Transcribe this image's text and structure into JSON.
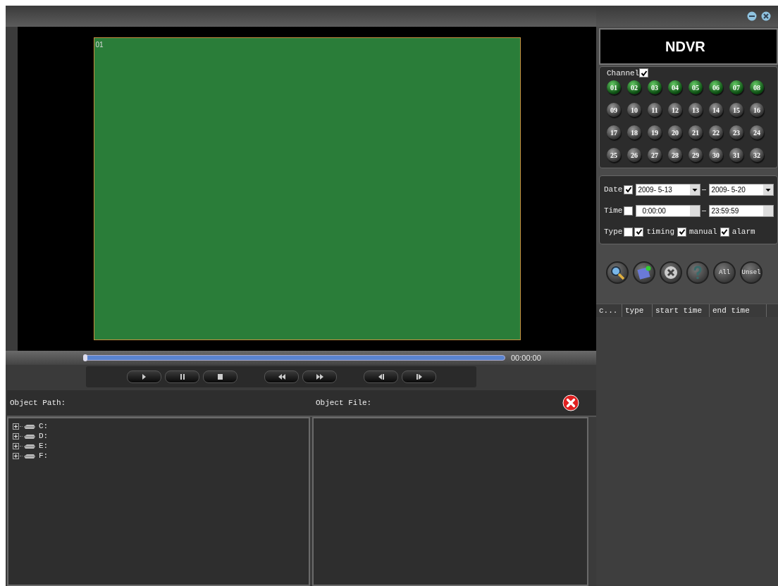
{
  "video": {
    "channel_label": "01"
  },
  "playback": {
    "level": 0,
    "time": "00:00:00",
    "button_groups": [
      {
        "buttons": [
          {
            "kind": "play"
          },
          {
            "kind": "pause"
          },
          {
            "kind": "stop"
          }
        ]
      },
      {
        "buttons": [
          {
            "kind": "rewind"
          },
          {
            "kind": "forward"
          }
        ]
      },
      {
        "buttons": [
          {
            "kind": "prev-frame"
          },
          {
            "kind": "next-frame"
          }
        ]
      }
    ]
  },
  "files": {
    "path_label": "Object Path:",
    "file_label": "Object File:",
    "drives": [
      {
        "label": "C:",
        "expanded": false
      },
      {
        "label": "D:",
        "expanded": false
      },
      {
        "label": "E:",
        "expanded": false
      },
      {
        "label": "F:",
        "expanded": false
      }
    ]
  },
  "panel": {
    "logo": "NDVR",
    "channel": {
      "label": "Channel",
      "checked": true,
      "channels": [
        {
          "label": "01",
          "selected": true
        },
        {
          "label": "02",
          "selected": true
        },
        {
          "label": "03",
          "selected": true
        },
        {
          "label": "04",
          "selected": true
        },
        {
          "label": "05",
          "selected": true
        },
        {
          "label": "06",
          "selected": true
        },
        {
          "label": "07",
          "selected": true
        },
        {
          "label": "08",
          "selected": true
        },
        {
          "label": "09",
          "selected": false
        },
        {
          "label": "10",
          "selected": false
        },
        {
          "label": "11",
          "selected": false
        },
        {
          "label": "12",
          "selected": false
        },
        {
          "label": "13",
          "selected": false
        },
        {
          "label": "14",
          "selected": false
        },
        {
          "label": "15",
          "selected": false
        },
        {
          "label": "16",
          "selected": false
        },
        {
          "label": "17",
          "selected": false
        },
        {
          "label": "18",
          "selected": false
        },
        {
          "label": "19",
          "selected": false
        },
        {
          "label": "20",
          "selected": false
        },
        {
          "label": "21",
          "selected": false
        },
        {
          "label": "22",
          "selected": false
        },
        {
          "label": "23",
          "selected": false
        },
        {
          "label": "24",
          "selected": false
        },
        {
          "label": "25",
          "selected": false
        },
        {
          "label": "26",
          "selected": false
        },
        {
          "label": "27",
          "selected": false
        },
        {
          "label": "28",
          "selected": false
        },
        {
          "label": "29",
          "selected": false
        },
        {
          "label": "30",
          "selected": false
        },
        {
          "label": "31",
          "selected": false
        },
        {
          "label": "32",
          "selected": false
        }
      ]
    },
    "date": {
      "label": "Date",
      "checked": true,
      "from": "2009- 5-13",
      "to": "2009- 5-20"
    },
    "time": {
      "label": "Time",
      "checked": false,
      "from": "0:00:00",
      "to": "23:59:59"
    },
    "type": {
      "label": "Type",
      "checked": false,
      "options": [
        {
          "label": "timing",
          "checked": true
        },
        {
          "label": "manual",
          "checked": true
        },
        {
          "label": "alarm",
          "checked": true
        }
      ]
    },
    "actions": [
      {
        "kind": "search"
      },
      {
        "kind": "save"
      },
      {
        "kind": "delete"
      },
      {
        "kind": "help"
      },
      {
        "kind": "text",
        "label": "All"
      },
      {
        "kind": "text",
        "label": "Unsel"
      }
    ],
    "columns": [
      "c...",
      "type",
      "start time",
      "end time"
    ]
  }
}
